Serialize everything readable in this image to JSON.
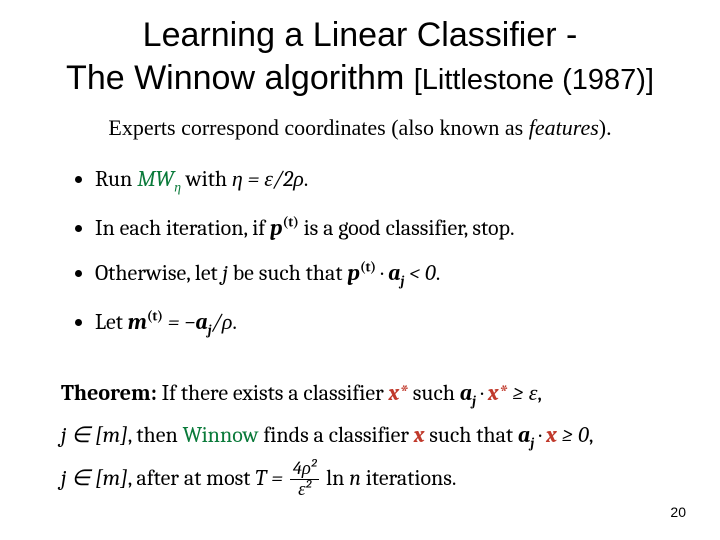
{
  "title": {
    "line1": "Learning a Linear Classifier -",
    "line2_main": "The Winnow algorithm",
    "citation": "[Littlestone (1987)]"
  },
  "subline": {
    "pre": "Experts correspond coordinates (also known as ",
    "ital": "features",
    "post": ")."
  },
  "steps": {
    "s1": {
      "run": "Run ",
      "mw": "MW",
      "eta": "η",
      "with": " with ",
      "eq": "η = ε/2ρ",
      "dot": "."
    },
    "s2": {
      "a": "In each iteration, if ",
      "p": "p",
      "sup": "(t)",
      "b": " is a good classifier, stop."
    },
    "s3": {
      "a": "Otherwise, let ",
      "j": "j",
      "b": " be such that ",
      "p": "p",
      "sup": "(t)",
      "dot": " · ",
      "aj_a": "a",
      "aj_j": "j",
      "lt": " < 0",
      "end": "."
    },
    "s4": {
      "a": "Let  ",
      "m": "m",
      "sup": "(t)",
      "eq": " = −",
      "aj_a": "a",
      "aj_j": "j",
      "rho": "/ρ",
      "end": "."
    }
  },
  "theorem": {
    "label": "Theorem:",
    "t1": " If there exists a classifier ",
    "xstar": "x*",
    "t2": " such ",
    "aj_a": "a",
    "aj_j": "j",
    "dot": " · ",
    "ge_eps": " ≥ ε",
    "comma1": ", ",
    "jin": "j ∈ [m]",
    "then": ", then ",
    "winnow": "Winnow",
    "t3": " finds a classifier ",
    "x": "x",
    "t4": " such that ",
    "ge0": " ≥ 0",
    "comma2": ", ",
    "after": "after at most ",
    "Teq": "T = ",
    "frac_num": "4ρ²",
    "frac_den": "ε²",
    "ln": " ln ",
    "n": "n",
    "iter": " iterations."
  },
  "pagenum": "20"
}
